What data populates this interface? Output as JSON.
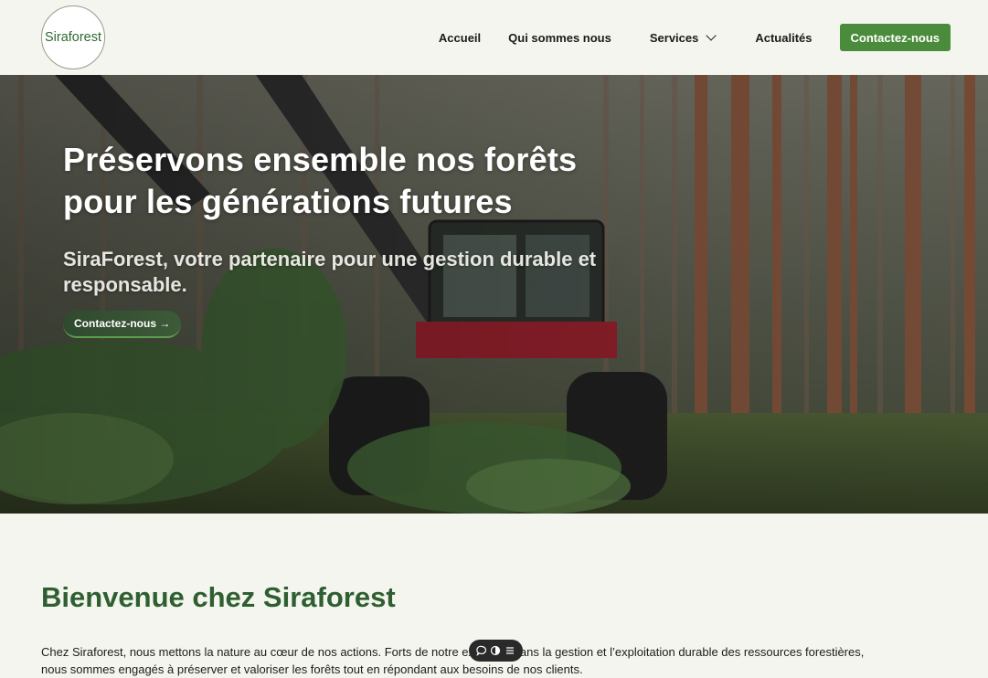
{
  "header": {
    "logo_text": "Siraforest",
    "nav": {
      "accueil": "Accueil",
      "qui": "Qui sommes nous",
      "services": "Services",
      "actus": "Actualités",
      "contact": "Contactez-nous"
    }
  },
  "hero": {
    "title_line1": "Préservons ensemble nos forêts",
    "title_line2": "pour les générations futures",
    "subtitle_line1": "SiraForest, votre partenaire pour une gestion durable et",
    "subtitle_line2": "responsable.",
    "button_label": "Contactez-nous →"
  },
  "welcome": {
    "title": "Bienvenue chez Siraforest",
    "text_line1": "Chez Siraforest, nous mettons la nature au cœur de nos actions. Forts de notre expertise dans la gestion et l’exploitation durable des ressources forestières,",
    "text_line2": "nous sommes engagés à préserver et valoriser les forêts tout en répondant aux besoins de nos clients."
  },
  "toolbar": {
    "icons": [
      "comment-icon",
      "contrast-icon",
      "menu-icon"
    ]
  },
  "colors": {
    "brand_green": "#4a8b3c",
    "title_green": "#2f5f31",
    "page_bg": "#f3f5ee"
  }
}
